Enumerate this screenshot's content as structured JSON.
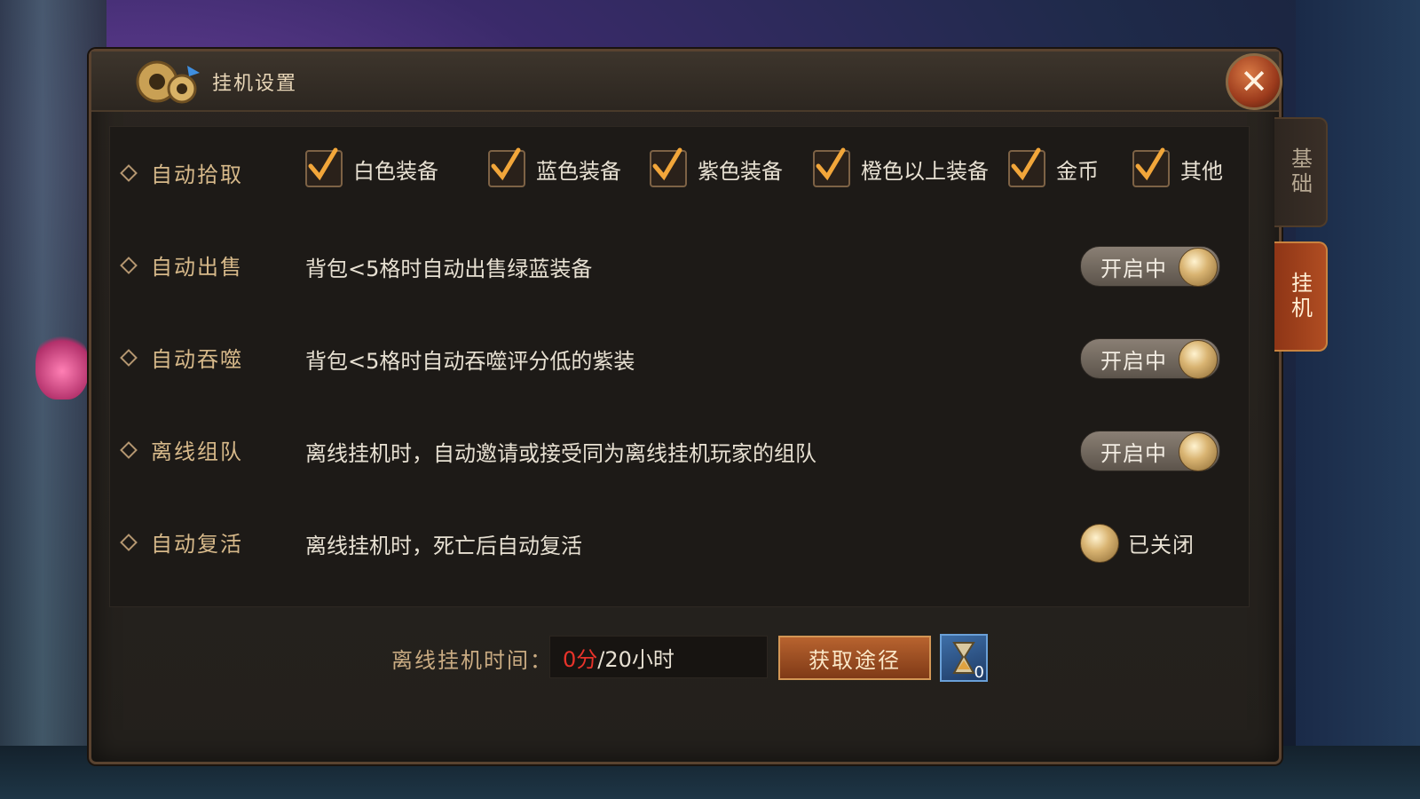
{
  "window": {
    "title": "挂机设置",
    "close_label": "✕"
  },
  "side_tabs": [
    {
      "label": "基础",
      "active": false
    },
    {
      "label": "挂机",
      "active": true
    }
  ],
  "rows": {
    "auto_pickup": {
      "label": "自动拾取",
      "options": [
        {
          "label": "白色装备",
          "checked": true
        },
        {
          "label": "蓝色装备",
          "checked": true
        },
        {
          "label": "紫色装备",
          "checked": true
        },
        {
          "label": "橙色以上装备",
          "checked": true
        },
        {
          "label": "金币",
          "checked": true
        },
        {
          "label": "其他",
          "checked": true
        }
      ]
    },
    "auto_sell": {
      "label": "自动出售",
      "desc": "背包<5格时自动出售绿蓝装备",
      "state_text": "开启中",
      "on": true
    },
    "auto_devour": {
      "label": "自动吞噬",
      "desc": "背包<5格时自动吞噬评分低的紫装",
      "state_text": "开启中",
      "on": true
    },
    "offline_team": {
      "label": "离线组队",
      "desc": "离线挂机时，自动邀请或接受同为离线挂机玩家的组队",
      "state_text": "开启中",
      "on": true
    },
    "auto_revive": {
      "label": "自动复活",
      "desc": "离线挂机时，死亡后自动复活",
      "state_text": "已关闭",
      "on": false
    }
  },
  "footer": {
    "time_label": "离线挂机时间：",
    "time_used": "0分",
    "time_total": "/20小时",
    "get_button": "获取途径",
    "item_count": "0",
    "item_icon": "hourglass-item-icon"
  },
  "colors": {
    "accent_orange": "#b8632f",
    "time_used_red": "#e8332a",
    "label_gold": "#d7b98a"
  }
}
